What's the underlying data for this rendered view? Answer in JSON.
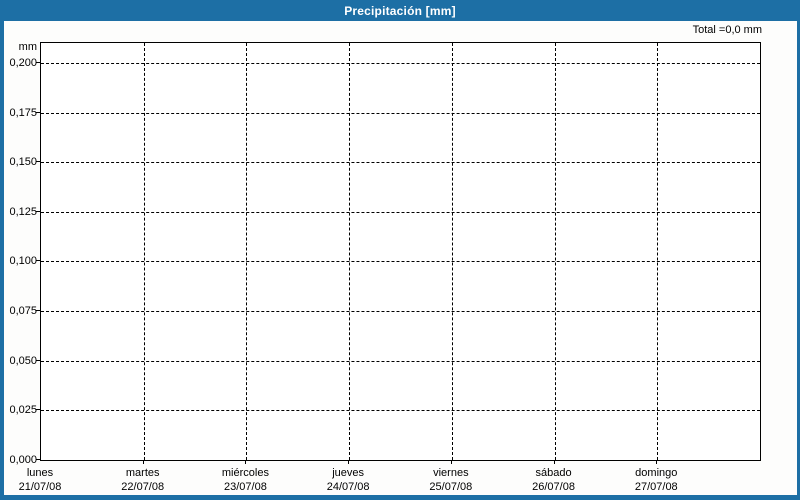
{
  "window": {
    "title": "Precipitación [mm]"
  },
  "header": {
    "total_label": "Total =0,0 mm"
  },
  "colors": {
    "header_blue": "#1d6fa5",
    "plot_border": "#000000",
    "plot_background": "#ffffff",
    "title_text": "#ffffff",
    "grid": "#000000"
  },
  "chart_data": {
    "type": "line",
    "title": "Precipitación [mm]",
    "ylabel": "mm",
    "unit": "mm",
    "ylim": [
      0,
      0.21
    ],
    "grid": true,
    "legend_position": "none",
    "total_mm": "0,0",
    "y_ticks": [
      {
        "value": 0.2,
        "label": "0,200"
      },
      {
        "value": 0.175,
        "label": "0,175"
      },
      {
        "value": 0.15,
        "label": "0,150"
      },
      {
        "value": 0.125,
        "label": "0,125"
      },
      {
        "value": 0.1,
        "label": "0,100"
      },
      {
        "value": 0.075,
        "label": "0,075"
      },
      {
        "value": 0.05,
        "label": "0,050"
      },
      {
        "value": 0.025,
        "label": "0,025"
      },
      {
        "value": 0.0,
        "label": "0,000"
      }
    ],
    "categories": [
      {
        "day": "lunes",
        "date": "21/07/08"
      },
      {
        "day": "martes",
        "date": "22/07/08"
      },
      {
        "day": "miércoles",
        "date": "23/07/08"
      },
      {
        "day": "jueves",
        "date": "24/07/08"
      },
      {
        "day": "viernes",
        "date": "25/07/08"
      },
      {
        "day": "sábado",
        "date": "26/07/08"
      },
      {
        "day": "domingo",
        "date": "27/07/08"
      }
    ],
    "series": [
      {
        "name": "Precipitación",
        "unit": "mm",
        "values": [
          0,
          0,
          0,
          0,
          0,
          0,
          0
        ]
      }
    ]
  }
}
